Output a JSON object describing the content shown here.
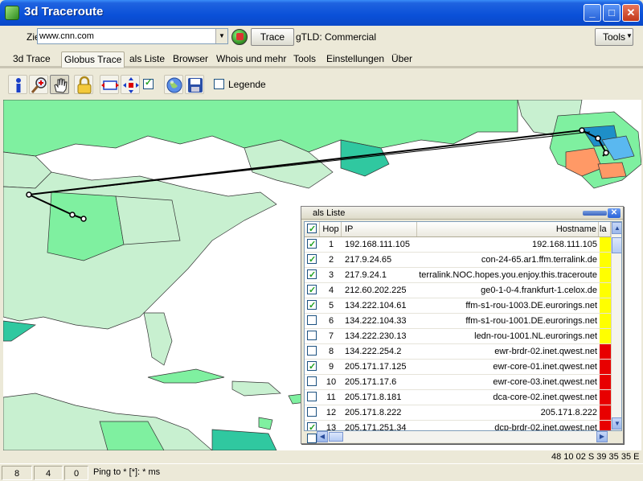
{
  "window": {
    "title": "3d Traceroute",
    "minimize_glyph": "_",
    "maximize_glyph": "□",
    "close_glyph": "✕"
  },
  "address_bar": {
    "label": "Ziel",
    "value": "www.cnn.com",
    "trace_button": "Trace",
    "gtld_text": "gTLD: Commercial",
    "tools_button": "Tools"
  },
  "tabs": [
    "3d Trace",
    "Globus Trace",
    "als Liste",
    "Browser",
    "Whois und mehr",
    "Tools",
    "Einstellungen",
    "Über"
  ],
  "active_tab_index": 1,
  "toolbar": {
    "legend_label": "Legende",
    "icons": [
      "info-icon",
      "zoom-in-icon",
      "pan-hand-icon",
      "lock-icon",
      "fit-icon",
      "move-icon",
      "checkbox-icon",
      "globe-icon",
      "save-icon"
    ]
  },
  "list_panel": {
    "title": "als Liste",
    "columns": [
      "Hop",
      "IP",
      "Hostname",
      "la"
    ],
    "rows": [
      {
        "hop": "1",
        "ip": "192.168.111.105",
        "host": "192.168.111.105",
        "checked": true,
        "status": "yellow"
      },
      {
        "hop": "2",
        "ip": "217.9.24.65",
        "host": "con-24-65.ar1.ffm.terralink.de",
        "checked": true,
        "status": "yellow"
      },
      {
        "hop": "3",
        "ip": "217.9.24.1",
        "host": "terralink.NOC.hopes.you.enjoy.this.traceroute",
        "checked": true,
        "status": "yellow"
      },
      {
        "hop": "4",
        "ip": "212.60.202.225",
        "host": "ge0-1-0-4.frankfurt-1.celox.de",
        "checked": true,
        "status": "yellow"
      },
      {
        "hop": "5",
        "ip": "134.222.104.61",
        "host": "ffm-s1-rou-1003.DE.eurorings.net",
        "checked": true,
        "status": "yellow"
      },
      {
        "hop": "6",
        "ip": "134.222.104.33",
        "host": "ffm-s1-rou-1001.DE.eurorings.net",
        "checked": false,
        "status": "yellow"
      },
      {
        "hop": "7",
        "ip": "134.222.230.13",
        "host": "ledn-rou-1001.NL.eurorings.net",
        "checked": false,
        "status": "yellow"
      },
      {
        "hop": "8",
        "ip": "134.222.254.2",
        "host": "ewr-brdr-02.inet.qwest.net",
        "checked": false,
        "status": "red"
      },
      {
        "hop": "9",
        "ip": "205.171.17.125",
        "host": "ewr-core-01.inet.qwest.net",
        "checked": true,
        "status": "red"
      },
      {
        "hop": "10",
        "ip": "205.171.17.6",
        "host": "ewr-core-03.inet.qwest.net",
        "checked": false,
        "status": "red"
      },
      {
        "hop": "11",
        "ip": "205.171.8.181",
        "host": "dca-core-02.inet.qwest.net",
        "checked": false,
        "status": "red"
      },
      {
        "hop": "12",
        "ip": "205.171.8.222",
        "host": "205.171.8.222",
        "checked": false,
        "status": "red"
      },
      {
        "hop": "13",
        "ip": "205.171.251.34",
        "host": "dcp-brdr-02.inet.qwest.net",
        "checked": true,
        "status": "red"
      }
    ]
  },
  "coordinates": "48 10 02 S  39 35 35 E",
  "status_bar": {
    "cells": [
      "8",
      "4",
      "0"
    ],
    "text": "Ping to * [*]: * ms"
  },
  "colors": {
    "ocean": "#ffffff",
    "land_green": "#7ff0a0",
    "land_light": "#c8f0d0",
    "land_teal": "#30c8a0",
    "status_yellow": "#ffff00",
    "status_red": "#e80000"
  }
}
